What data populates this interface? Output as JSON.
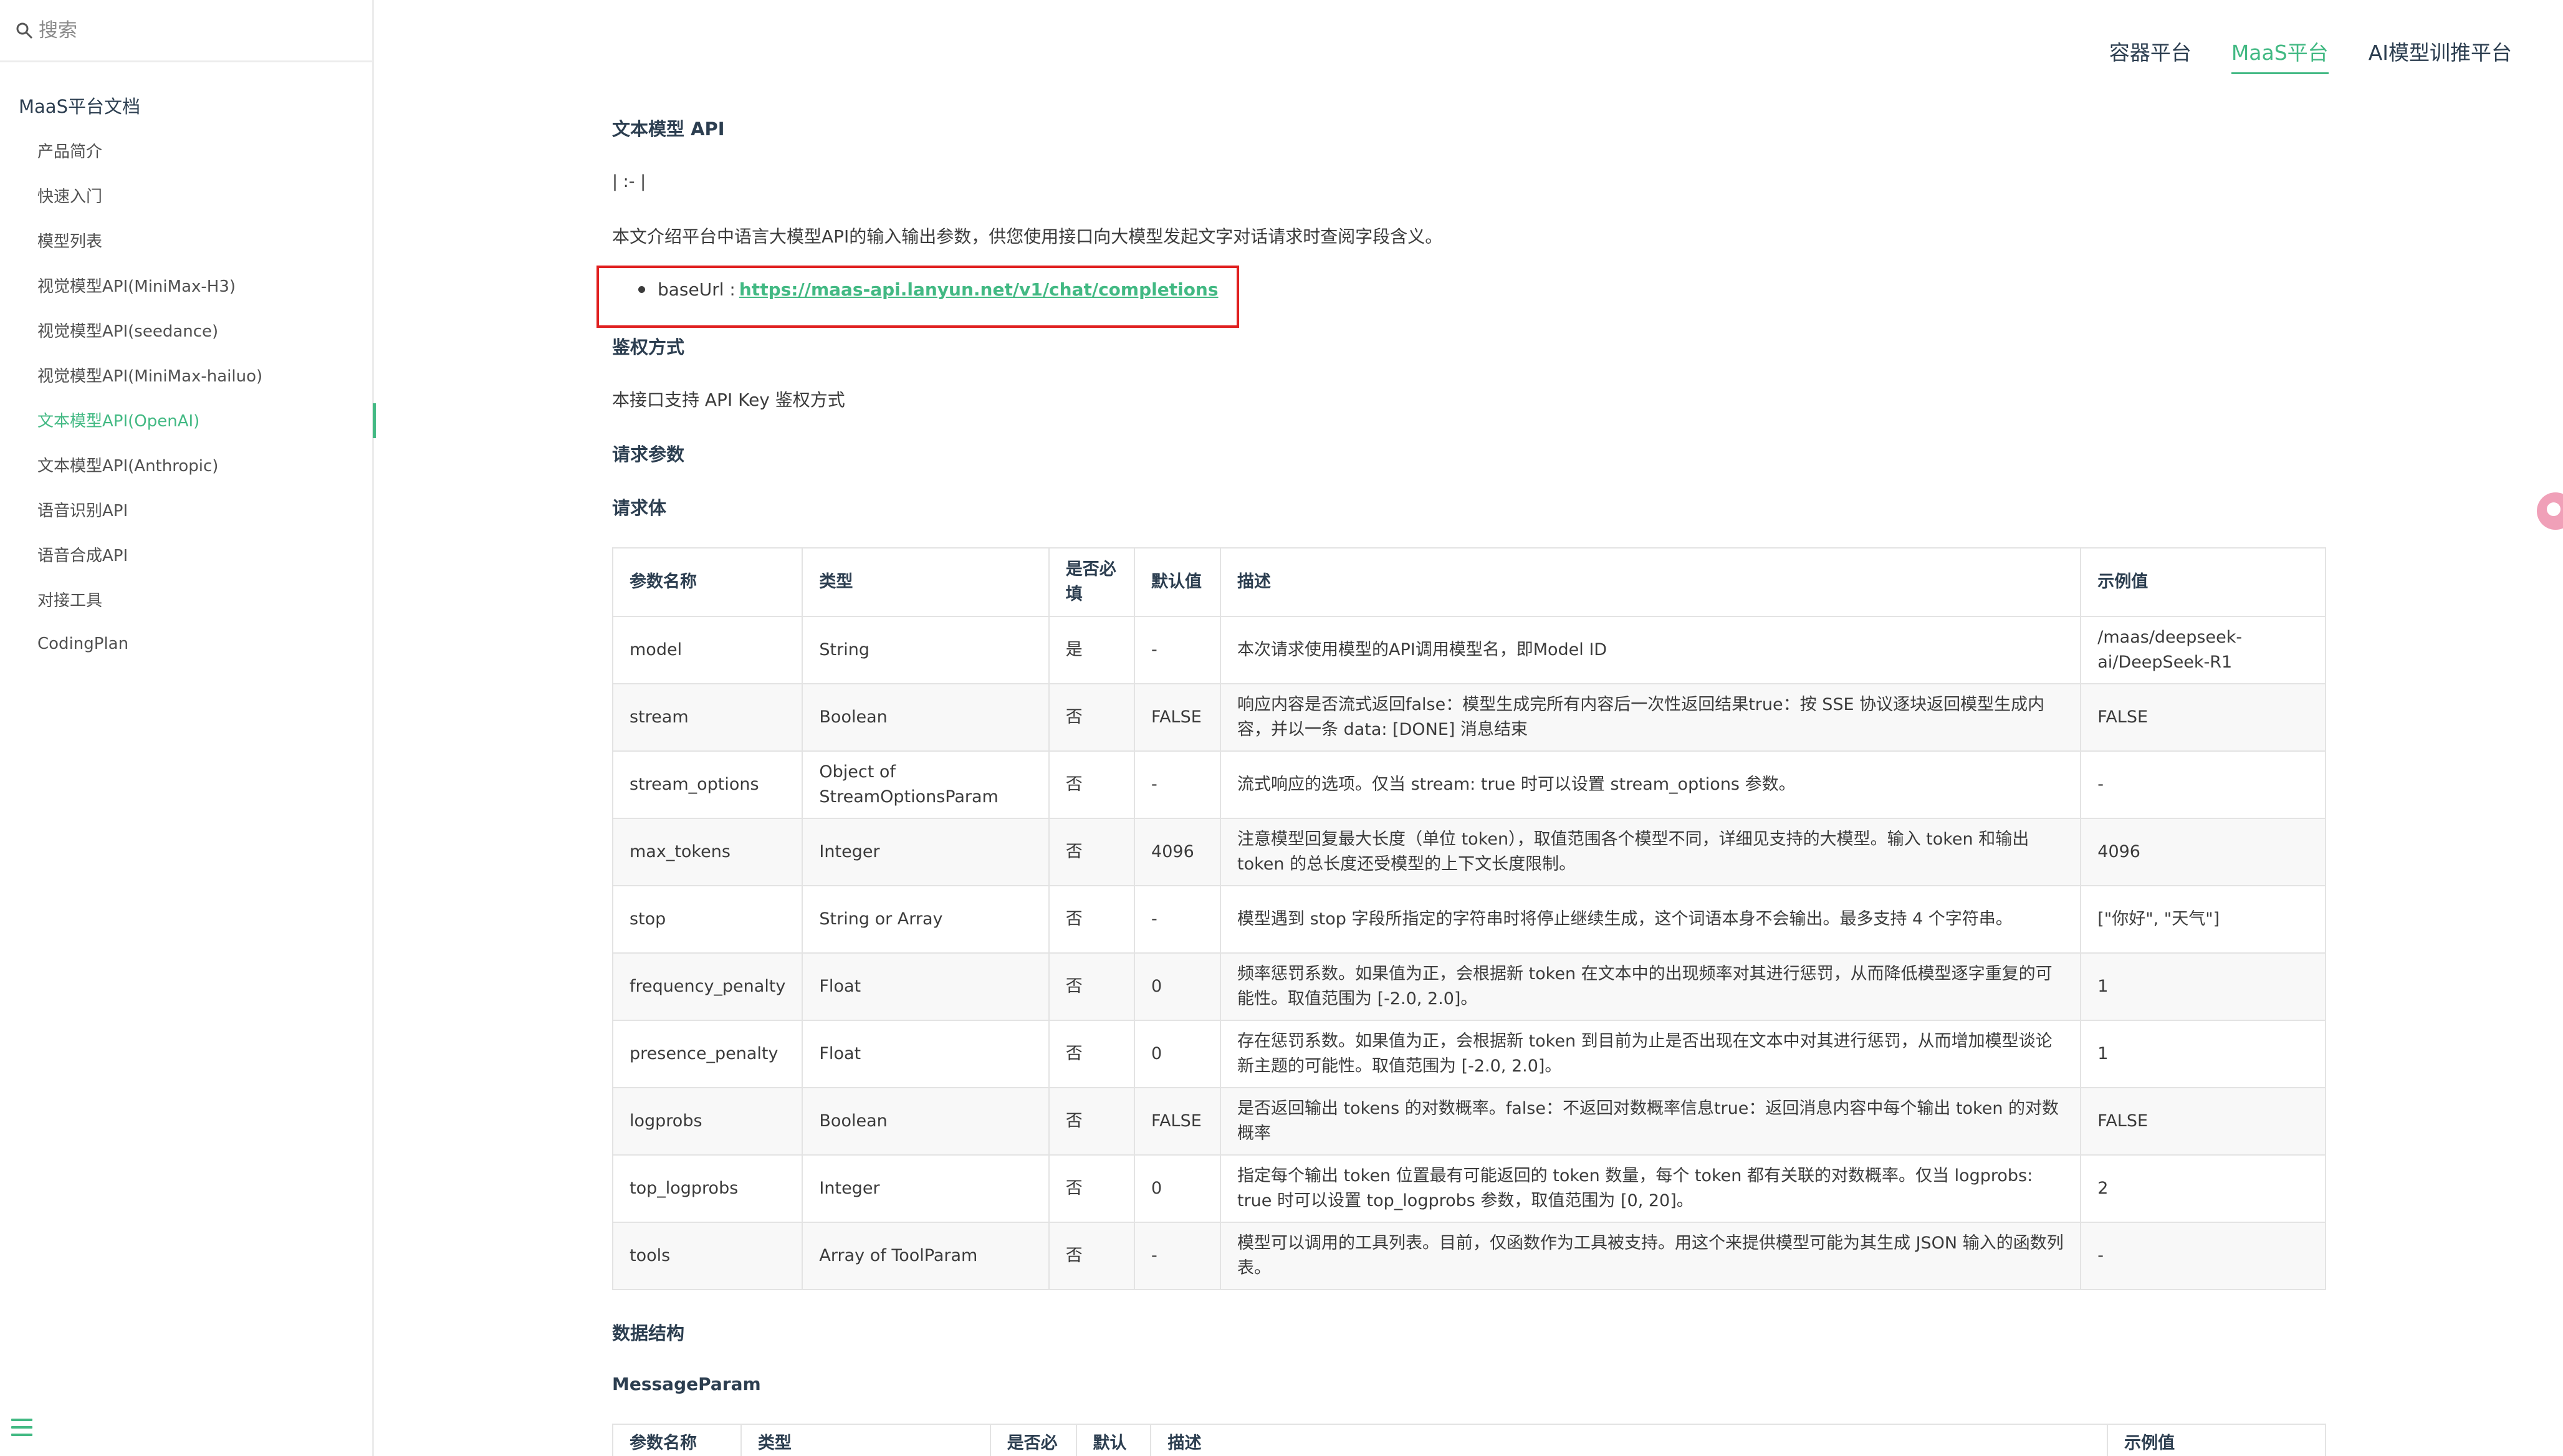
{
  "sidebar": {
    "search_placeholder": "搜索",
    "title": "MaaS平台文档",
    "items": [
      {
        "label": "产品简介"
      },
      {
        "label": "快速入门"
      },
      {
        "label": "模型列表"
      },
      {
        "label": "视觉模型API(MiniMax-H3)"
      },
      {
        "label": "视觉模型API(seedance)"
      },
      {
        "label": "视觉模型API(MiniMax-hailuo)"
      },
      {
        "label": "文本模型API(OpenAI)"
      },
      {
        "label": "文本模型API(Anthropic)"
      },
      {
        "label": "语音识别API"
      },
      {
        "label": "语音合成API"
      },
      {
        "label": "对接工具"
      },
      {
        "label": "CodingPlan"
      }
    ],
    "active_index": 6
  },
  "topnav": {
    "items": [
      {
        "label": "容器平台"
      },
      {
        "label": "MaaS平台"
      },
      {
        "label": "AI模型训推平台"
      }
    ],
    "active_index": 1
  },
  "doc": {
    "heading": "文本模型 API",
    "pipe_line": "| :- |",
    "intro": "本文介绍平台中语言大模型API的输入输出参数，供您使用接口向大模型发起文字对话请求时查阅字段含义。",
    "base_url_label": "baseUrl :",
    "base_url": "https://maas-api.lanyun.net/v1/chat/completions",
    "auth_heading": "鉴权方式",
    "auth_text": "本接口支持 API Key 鉴权方式",
    "request_params_heading": "请求参数",
    "request_body_heading": "请求体",
    "data_struct_heading": "数据结构",
    "message_param_heading": "MessageParam"
  },
  "table": {
    "headers": [
      "参数名称",
      "类型",
      "是否必填",
      "默认值",
      "描述",
      "示例值"
    ],
    "rows": [
      [
        "model",
        "String",
        "是",
        "-",
        "本次请求使用模型的API调用模型名，即Model ID",
        "/maas/deepseek-ai/DeepSeek-R1"
      ],
      [
        "stream",
        "Boolean",
        "否",
        "FALSE",
        "响应内容是否流式返回false：模型生成完所有内容后一次性返回结果true：按 SSE 协议逐块返回模型生成内容，并以一条 data: [DONE] 消息结束",
        "FALSE"
      ],
      [
        "stream_options",
        "Object of StreamOptionsParam",
        "否",
        "-",
        "流式响应的选项。仅当 stream: true 时可以设置 stream_options 参数。",
        "-"
      ],
      [
        "max_tokens",
        "Integer",
        "否",
        "4096",
        "注意模型回复最大长度（单位 token），取值范围各个模型不同，详细见支持的大模型。输入 token 和输出 token 的总长度还受模型的上下文长度限制。",
        "4096"
      ],
      [
        "stop",
        "String or Array",
        "否",
        "-",
        "模型遇到 stop 字段所指定的字符串时将停止继续生成，这个词语本身不会输出。最多支持 4 个字符串。",
        "[\"你好\", \"天气\"]"
      ],
      [
        "frequency_penalty",
        "Float",
        "否",
        "0",
        "频率惩罚系数。如果值为正，会根据新 token 在文本中的出现频率对其进行惩罚，从而降低模型逐字重复的可能性。取值范围为 [-2.0, 2.0]。",
        "1"
      ],
      [
        "presence_penalty",
        "Float",
        "否",
        "0",
        "存在惩罚系数。如果值为正，会根据新 token 到目前为止是否出现在文本中对其进行惩罚，从而增加模型谈论新主题的可能性。取值范围为 [-2.0, 2.0]。",
        "1"
      ],
      [
        "logprobs",
        "Boolean",
        "否",
        "FALSE",
        "是否返回输出 tokens 的对数概率。false：不返回对数概率信息true：返回消息内容中每个输出 token 的对数概率",
        "FALSE"
      ],
      [
        "top_logprobs",
        "Integer",
        "否",
        "0",
        "指定每个输出 token 位置最有可能返回的 token 数量，每个 token 都有关联的对数概率。仅当 logprobs: true 时可以设置 top_logprobs 参数，取值范围为 [0, 20]。",
        "2"
      ],
      [
        "tools",
        "Array of ToolParam",
        "否",
        "-",
        "模型可以调用的工具列表。目前，仅函数作为工具被支持。用这个来提供模型可能为其生成 JSON 输入的函数列表。",
        "-"
      ]
    ]
  },
  "table2": {
    "headers": [
      "参数名称",
      "类型",
      "是否必填",
      "默认值",
      "描述",
      "示例值"
    ]
  },
  "colors": {
    "accent": "#42b983",
    "highlight_box": "#e02020"
  }
}
